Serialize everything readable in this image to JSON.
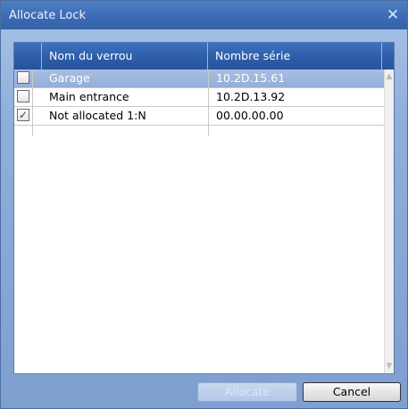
{
  "window": {
    "title": "Allocate Lock",
    "close_glyph": "✕",
    "close_icon": "close-icon"
  },
  "table": {
    "columns": [
      "Nom du verrou",
      "Nombre série"
    ],
    "rows": [
      {
        "name": "Garage",
        "serial": "10.2D.15.61",
        "checked": false,
        "selected": true
      },
      {
        "name": "Main entrance",
        "serial": "10.2D.13.92",
        "checked": false,
        "selected": false
      },
      {
        "name": "Not allocated 1:N",
        "serial": "00.00.00.00",
        "checked": true,
        "selected": false
      }
    ]
  },
  "scroll": {
    "up_glyph": "▲",
    "down_glyph": "▼"
  },
  "buttons": {
    "allocate": "Allocate",
    "cancel": "Cancel"
  }
}
